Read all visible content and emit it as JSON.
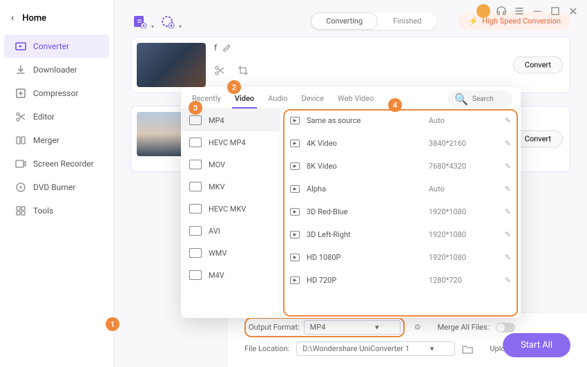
{
  "home_label": "Home",
  "sidebar": {
    "items": [
      {
        "label": "Converter"
      },
      {
        "label": "Downloader"
      },
      {
        "label": "Compressor"
      },
      {
        "label": "Editor"
      },
      {
        "label": "Merger"
      },
      {
        "label": "Screen Recorder"
      },
      {
        "label": "DVD Burner"
      },
      {
        "label": "Tools"
      }
    ]
  },
  "toggle": {
    "converting": "Converting",
    "finished": "Finished"
  },
  "hsc": "High Speed Conversion",
  "card": {
    "title_prefix": "f",
    "convert": "Convert"
  },
  "popout": {
    "tabs": {
      "recently": "Recently",
      "video": "Video",
      "audio": "Audio",
      "device": "Device",
      "web": "Web Video"
    },
    "search_placeholder": "Search",
    "formats": [
      {
        "label": "MP4"
      },
      {
        "label": "HEVC MP4"
      },
      {
        "label": "MOV"
      },
      {
        "label": "MKV"
      },
      {
        "label": "HEVC MKV"
      },
      {
        "label": "AVI"
      },
      {
        "label": "WMV"
      },
      {
        "label": "M4V"
      }
    ],
    "rows": [
      {
        "label": "Same as source",
        "res": "Auto"
      },
      {
        "label": "4K Video",
        "res": "3840*2160"
      },
      {
        "label": "8K Video",
        "res": "7680*4320"
      },
      {
        "label": "Alpha",
        "res": "Auto"
      },
      {
        "label": "3D Red-Blue",
        "res": "1920*1080"
      },
      {
        "label": "3D Left-Right",
        "res": "1920*1080"
      },
      {
        "label": "HD 1080P",
        "res": "1920*1080"
      },
      {
        "label": "HD 720P",
        "res": "1280*720"
      }
    ]
  },
  "bottom": {
    "output_label": "Output Format:",
    "output_value": "MP4",
    "file_label": "File Location:",
    "file_value": "D:\\Wondershare UniConverter 1",
    "merge_label": "Merge All Files:",
    "upload_label": "Upload to Cloud",
    "start": "Start All"
  },
  "badges": {
    "1": "1",
    "2": "2",
    "3": "3",
    "4": "4"
  }
}
